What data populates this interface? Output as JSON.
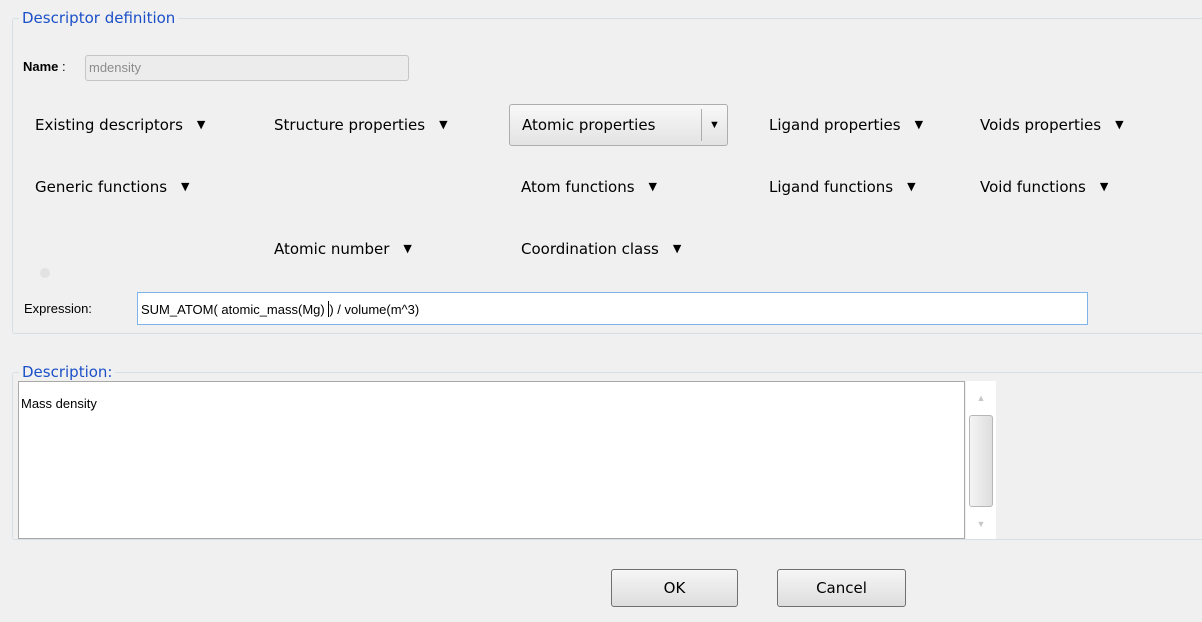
{
  "descriptor_group": {
    "legend": "Descriptor definition",
    "name_label": "Name",
    "name_colon": ":",
    "name_value": "mdensity"
  },
  "menus": {
    "existing_descriptors": "Existing descriptors",
    "structure_properties": "Structure properties",
    "atomic_properties": "Atomic properties",
    "ligand_properties": "Ligand properties",
    "voids_properties": "Voids properties",
    "generic_functions": "Generic functions",
    "atom_functions": "Atom functions",
    "ligand_functions": "Ligand functions",
    "void_functions": "Void functions",
    "atomic_number": "Atomic number",
    "coordination_class": "Coordination class"
  },
  "expression": {
    "label": "Expression:",
    "value_before_caret": "SUM_ATOM( atomic_mass(Mg) ",
    "value_after_caret": ") / volume(m^3)"
  },
  "description_group": {
    "legend": "Description:",
    "text": "Mass density"
  },
  "buttons": {
    "ok": "OK",
    "cancel": "Cancel"
  },
  "icons": {
    "dropdown": "caret-down-icon",
    "scroll_up": "scroll-up-arrow-icon",
    "scroll_down": "scroll-down-arrow-icon"
  },
  "colors": {
    "legend": "#1c50c8",
    "focus_border": "#7eb4ea",
    "background": "#f0f0f0"
  }
}
